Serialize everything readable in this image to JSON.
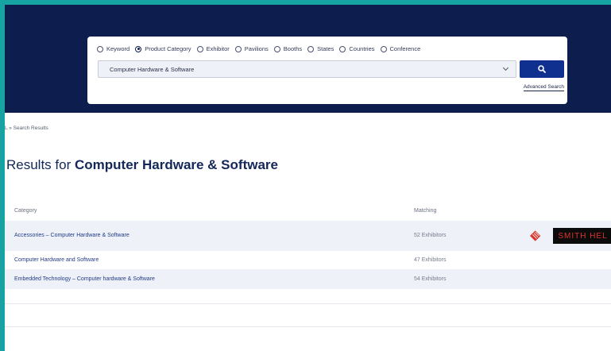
{
  "search": {
    "radio_options": [
      {
        "label": "Keyword",
        "checked": false
      },
      {
        "label": "Product Category",
        "checked": true
      },
      {
        "label": "Exhibitor",
        "checked": false
      },
      {
        "label": "Pavilions",
        "checked": false
      },
      {
        "label": "Booths",
        "checked": false
      },
      {
        "label": "States",
        "checked": false
      },
      {
        "label": "Countries",
        "checked": false
      },
      {
        "label": "Conference",
        "checked": false
      }
    ],
    "selected_category": "Computer Hardware & Software",
    "search_icon": "search-icon",
    "advanced_link": "Advanced Search"
  },
  "breadcrumb": {
    "home": "L",
    "separator": "»",
    "current": "Search Results"
  },
  "results": {
    "prefix": "Results for ",
    "query": "Computer Hardware & Software",
    "columns": {
      "category": "Category",
      "matching": "Matching"
    },
    "rows": [
      {
        "category": "Accessories – Computer Hardware & Software",
        "matching": "52 Exhibitors"
      },
      {
        "category": "Computer Hardware and Software",
        "matching": "47 Exhibitors"
      },
      {
        "category": "Embedded Technology – Computer hardware & Software",
        "matching": "54 Exhibitors"
      }
    ]
  },
  "sponsor": {
    "text": "SMITH HEL",
    "icon": "smith-logo-icon"
  },
  "colors": {
    "navy": "#0d1d4d",
    "accent": "#10308f",
    "frame": "#18a3a3",
    "link": "#223a86"
  }
}
